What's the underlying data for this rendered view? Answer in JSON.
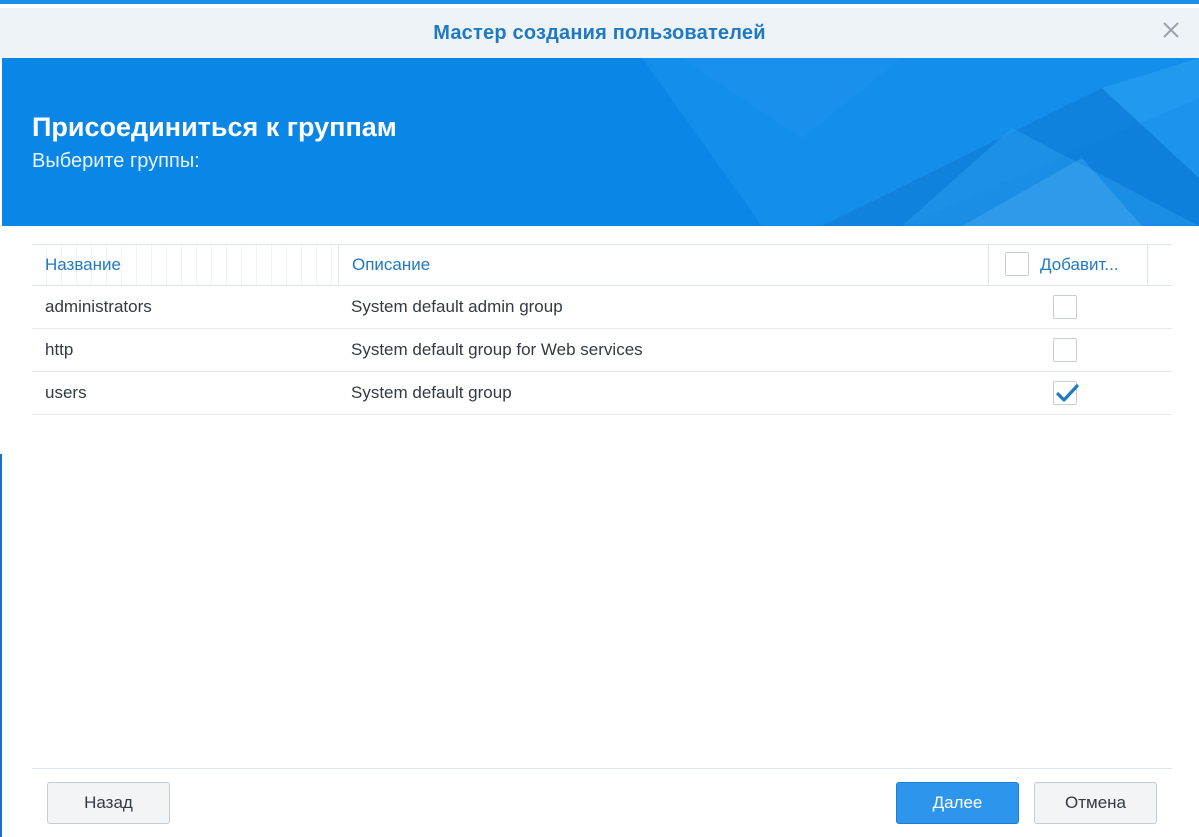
{
  "window": {
    "title": "Мастер создания пользователей"
  },
  "banner": {
    "heading": "Присоединиться к группам",
    "subheading": "Выберите группы:"
  },
  "table": {
    "columns": {
      "name": "Название",
      "description": "Описание",
      "add": "Добавит..."
    },
    "select_all_checked": false,
    "rows": [
      {
        "name": "administrators",
        "description": "System default admin group",
        "checked": false
      },
      {
        "name": "http",
        "description": "System default group for Web services",
        "checked": false
      },
      {
        "name": "users",
        "description": "System default group",
        "checked": true
      }
    ]
  },
  "buttons": {
    "back": "Назад",
    "next": "Далее",
    "cancel": "Отмена"
  },
  "colors": {
    "accent": "#1f7ac3",
    "banner": "#0a86e6",
    "primary_button": "#2e95ec"
  },
  "icons": {
    "close": "close-icon",
    "check": "checkmark-icon"
  }
}
